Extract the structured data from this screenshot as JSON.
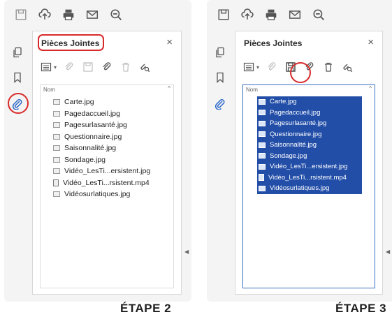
{
  "panel": {
    "title": "Pièces Jointes",
    "close": "×",
    "column_header": "Nom",
    "sort_indicator": "^",
    "files": [
      {
        "name": "Carte.jpg",
        "type": "image"
      },
      {
        "name": "Pagedaccueil.jpg",
        "type": "image"
      },
      {
        "name": "Pagesurlasanté.jpg",
        "type": "image"
      },
      {
        "name": "Questionnaire.jpg",
        "type": "image"
      },
      {
        "name": "Saisonnalité.jpg",
        "type": "image"
      },
      {
        "name": "Sondage.jpg",
        "type": "image"
      },
      {
        "name": "Vidéo_LesTi...ersistent.jpg",
        "type": "image"
      },
      {
        "name": "Vidéo_LesTi...rsistent.mp4",
        "type": "video"
      },
      {
        "name": "Vidéosurlatiques.jpg",
        "type": "image"
      }
    ]
  },
  "panel2": {
    "title": "Pièces Jointes",
    "close": "×",
    "column_header": "Nom",
    "sort_indicator": "^"
  },
  "steps": {
    "step2": "ÉTAPE 2",
    "step3": "ÉTAPE 3"
  },
  "colors": {
    "highlight": "#d92a2a",
    "selection": "#224ea8",
    "accent_blue": "#3a6fc0"
  }
}
